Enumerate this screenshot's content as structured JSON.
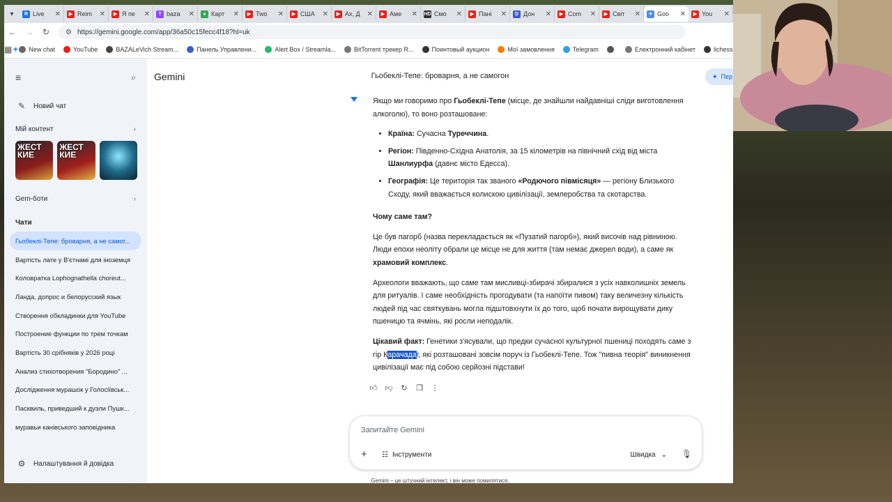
{
  "tabs": [
    {
      "label": "Live",
      "color": "#1a73e8",
      "glyph": "R"
    },
    {
      "label": "Reim",
      "color": "#e62117",
      "glyph": "▶"
    },
    {
      "label": "Я пе",
      "color": "#e62117",
      "glyph": "▶"
    },
    {
      "label": "baza",
      "color": "#9146ff",
      "glyph": "T"
    },
    {
      "label": "Карт",
      "color": "#34a853",
      "glyph": "●"
    },
    {
      "label": "Two",
      "color": "#e62117",
      "glyph": "▶"
    },
    {
      "label": "США",
      "color": "#e62117",
      "glyph": "▶"
    },
    {
      "label": "Ах, Д",
      "color": "#e62117",
      "glyph": "▶"
    },
    {
      "label": "Аме",
      "color": "#e62117",
      "glyph": "▶"
    },
    {
      "label": "Смо",
      "color": "#333333",
      "glyph": "HD"
    },
    {
      "label": "Пані",
      "color": "#e62117",
      "glyph": "▶"
    },
    {
      "label": "Дон",
      "color": "#3b5ccc",
      "glyph": "D"
    },
    {
      "label": "Com",
      "color": "#e62117",
      "glyph": "▶"
    },
    {
      "label": "Світ",
      "color": "#e62117",
      "glyph": "▶"
    },
    {
      "label": "Goo",
      "color": "#4a8df6",
      "glyph": "✦",
      "active": true
    },
    {
      "label": "You",
      "color": "#e62117",
      "glyph": "▶"
    }
  ],
  "address": {
    "url": "https://gemini.google.com/app/36a50c15fecc4f18?hl=uk"
  },
  "bookmarks": [
    {
      "label": "New chat",
      "color": "#666666"
    },
    {
      "label": "YouTube",
      "color": "#e62117"
    },
    {
      "label": "BAZALeVich Stream...",
      "color": "#444444"
    },
    {
      "label": "Панель Управлени...",
      "color": "#3b5ccc"
    },
    {
      "label": "Alert Box / Streamla...",
      "color": "#23b86b"
    },
    {
      "label": "BitTorrent трекер R...",
      "color": "#777777"
    },
    {
      "label": "Поинтовый аукцион",
      "color": "#333333"
    },
    {
      "label": "Мої замовлення",
      "color": "#ff7a00"
    },
    {
      "label": "Telegram",
      "color": "#2aa3e0"
    },
    {
      "label": "",
      "color": "#555555"
    },
    {
      "label": "Електронний кабінет",
      "color": "#777777"
    },
    {
      "label": "lichess.org • Беспла...",
      "color": "#333333"
    }
  ],
  "sidebar": {
    "new_chat": "Новий чат",
    "my_content": "Мій контент",
    "thumbs": [
      {
        "text": "ЖЕСТ КИЕ"
      },
      {
        "text": "ЖЕСТ КИЕ"
      },
      {
        "text": ""
      }
    ],
    "gems": "Gem-боти",
    "chats_title": "Чати",
    "chats": [
      "Гьобеклі-Тепе: броварня, а не самог...",
      "Вартість лате у В'єтнамі для іноземця",
      "Коловратка Lophognathella choreut...",
      "Ланда, допрос и белорусский язык",
      "Створення обкладинки для YouTube",
      "Построение функции по трем точкам",
      "Вартість 30 срібняків у 2026 році",
      "Анализ стихотворения \"Бородино\" ...",
      "Дослідження мурашок у Голосіївськ...",
      "Пасквиль, приведший к дуэли Пушк...",
      "муравьи канівського заповідника"
    ],
    "settings": "Налаштування й довідка"
  },
  "header": {
    "brand": "Gemini",
    "title": "Гьобеклі-Тепе: броварня, а не самогон",
    "upgrade": "Пер"
  },
  "response": {
    "intro_a": "Якщо ми говоримо про ",
    "intro_b": "Гьобеклі-Тепе",
    "intro_c": " (місце, де знайшли найдавніші сліди виготовлення алкоголю), то воно розташоване:",
    "b1_label": "Країна:",
    "b1_a": " Сучасна ",
    "b1_b": "Туреччина",
    "b1_c": ".",
    "b2_label": "Регіон:",
    "b2_a": " Південно-Східна Анатолія, за 15 кілометрів на північний схід від міста ",
    "b2_b": "Шанлиурфа",
    "b2_c": " (давнє місто Едесса).",
    "b3_label": "Географія:",
    "b3_a": " Це територія так званого ",
    "b3_b": "«Родючого півмісяця»",
    "b3_c": " — регіону Близького Сходу, який вважається колискою цивілізації, землеробства та скотарства.",
    "why_title": "Чому саме там?",
    "p1_a": "Це був пагорб (назва перекладається як «Пузатий пагорб»), який височів над рівниною. Люди епохи неоліту обрали це місце не для життя (там немає джерел води), а саме як ",
    "p1_b": "храмовий комплекс",
    "p1_c": ".",
    "p2": "Археологи вважають, що саме там мисливці-збирачі збиралися з усіх навколишніх земель для ритуалів. І саме необхідність прогодувати (та напоїти пивом) таку величезну кількість людей під час святкувань могла підштовхнути їх до того, щоб почати вирощувати дику пшеницю та ячмінь, які росли неподалік.",
    "fact_label": "Цікавий факт:",
    "fact_a": " Генетики з'ясували, що предки сучасної культурної пшениці походять саме з гір К",
    "fact_sel": "арачада",
    "fact_b": "г, які розташовані зовсім поруч із Гьобеклі-Тепе. Тож \"пивна теорія\" виникнення цивілізації має під собою серйозні підстави!"
  },
  "composer": {
    "placeholder": "Запитайте Gemini",
    "tools": "Інструменти",
    "speed": "Швидка"
  },
  "disclaimer": "Gemini – це штучний інтелект, і він може помилятися."
}
